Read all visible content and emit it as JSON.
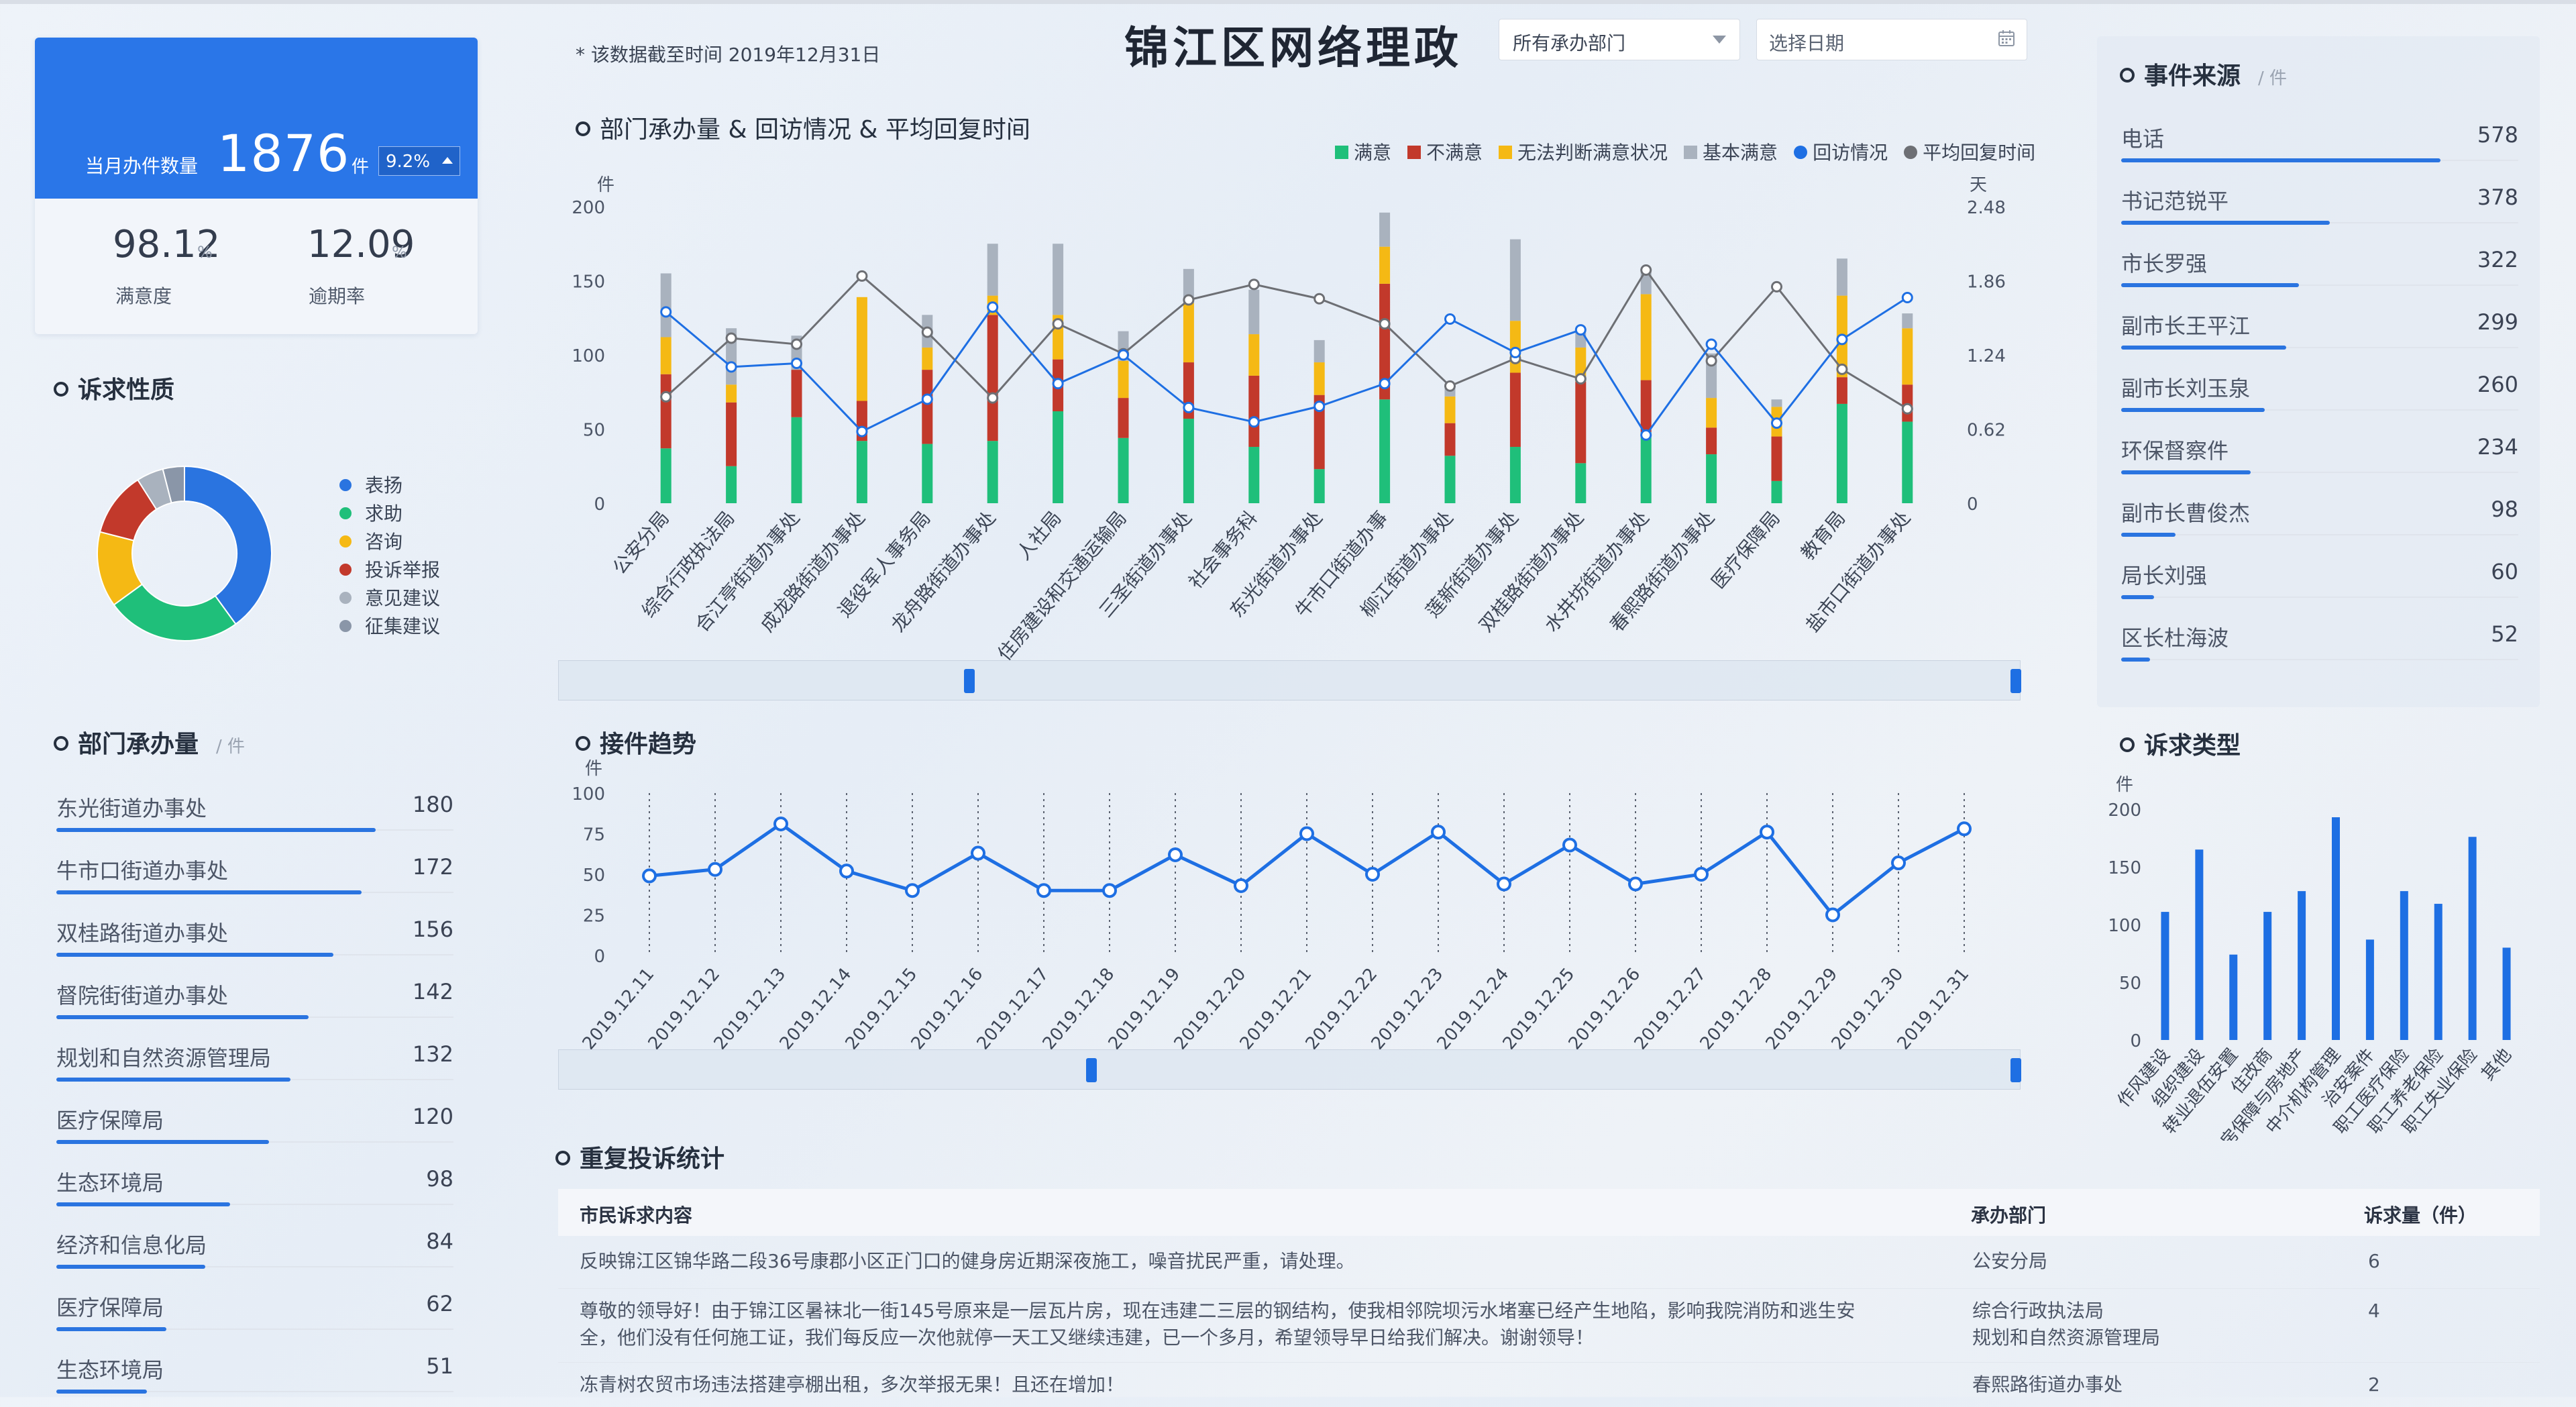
{
  "kpi": {
    "monthly_label": "当月办件数量",
    "monthly_value": "1876",
    "monthly_unit": "件",
    "monthly_change": "9.2%",
    "satisfaction_value": "98.12",
    "satisfaction_unit": "%",
    "satisfaction_label": "满意度",
    "overdue_value": "12.09",
    "overdue_unit": "%",
    "overdue_label": "逾期率"
  },
  "header": {
    "note": "* 该数据截至时间 2019年12月31日",
    "title": "锦江区网络理政",
    "dept_select": "所有承办部门",
    "date_placeholder": "选择日期"
  },
  "appeal_nature": {
    "title": "诉求性质",
    "items": [
      {
        "label": "表扬",
        "value": 40,
        "color": "#2a74e0"
      },
      {
        "label": "求助",
        "value": 25,
        "color": "#1fbf7a"
      },
      {
        "label": "咨询",
        "value": 14,
        "color": "#f5b914"
      },
      {
        "label": "投诉举报",
        "value": 12,
        "color": "#c2392b"
      },
      {
        "label": "意见建议",
        "value": 5,
        "color": "#a9b2be"
      },
      {
        "label": "征集建议",
        "value": 4,
        "color": "#8a96a8"
      }
    ]
  },
  "dept_volume": {
    "title": "部门承办量",
    "unit": "/ 件",
    "items": [
      {
        "name": "东光街道办事处",
        "value": 180
      },
      {
        "name": "牛市口街道办事处",
        "value": 172
      },
      {
        "name": "双桂路街道办事处",
        "value": 156
      },
      {
        "name": "督院街街道办事处",
        "value": 142
      },
      {
        "name": "规划和自然资源管理局",
        "value": 132
      },
      {
        "name": "医疗保障局",
        "value": 120
      },
      {
        "name": "生态环境局",
        "value": 98
      },
      {
        "name": "经济和信息化局",
        "value": 84
      },
      {
        "name": "医疗保障局",
        "value": 62
      },
      {
        "name": "生态环境局",
        "value": 51
      }
    ]
  },
  "event_source": {
    "title": "事件来源",
    "unit": "/ 件",
    "items": [
      {
        "name": "电话",
        "value": 578
      },
      {
        "name": "书记范锐平",
        "value": 378
      },
      {
        "name": "市长罗强",
        "value": 322
      },
      {
        "name": "副市长王平江",
        "value": 299
      },
      {
        "name": "副市长刘玉泉",
        "value": 260
      },
      {
        "name": "环保督察件",
        "value": 234
      },
      {
        "name": "副市长曹俊杰",
        "value": 98
      },
      {
        "name": "局长刘强",
        "value": 60
      },
      {
        "name": "区长杜海波",
        "value": 52
      }
    ]
  },
  "chart_data": [
    {
      "type": "bar",
      "title": "部门承办量 & 回访情况 & 平均回复时间",
      "ylabel": "件",
      "y2label": "天",
      "ylim": [
        0,
        200
      ],
      "y2lim": [
        0,
        2.48
      ],
      "yticks": [
        "0",
        "50",
        "100",
        "150",
        "200"
      ],
      "y2ticks": [
        "0",
        "0.62",
        "1.24",
        "1.86",
        "2.48"
      ],
      "legend_position": "top-right",
      "categories": [
        "公安分局",
        "综合行政执法局",
        "合江亭街道办事处",
        "成龙路街道办事处",
        "退役军人事务局",
        "龙舟路街道办事处",
        "人社局",
        "住房建设和交通运输局",
        "三圣街道办事处",
        "社会事务科",
        "东光街道办事处",
        "牛市口街道办事",
        "柳江街道办事处",
        "莲新街道办事处",
        "双桂路街道办事处",
        "水井坊街道办事处",
        "春熙路街道办事处",
        "医疗保障局",
        "教育局",
        "盐市口街道办事处"
      ],
      "stack_colors": [
        "#1fbf7a",
        "#c2392b",
        "#f5b914",
        "#a9b2be"
      ],
      "series": [
        {
          "name": "满意",
          "values": [
            37,
            25,
            58,
            42,
            40,
            42,
            62,
            44,
            57,
            38,
            23,
            70,
            32,
            38,
            27,
            48,
            33,
            15,
            67,
            55
          ]
        },
        {
          "name": "不满意",
          "values": [
            50,
            43,
            32,
            27,
            50,
            85,
            35,
            27,
            38,
            48,
            50,
            78,
            22,
            50,
            55,
            35,
            18,
            30,
            18,
            25
          ]
        },
        {
          "name": "无法判断满意状况",
          "values": [
            25,
            12,
            0,
            70,
            15,
            13,
            30,
            25,
            40,
            28,
            22,
            25,
            18,
            35,
            23,
            58,
            20,
            20,
            55,
            38
          ]
        },
        {
          "name": "基本满意",
          "values": [
            43,
            38,
            23,
            0,
            22,
            35,
            48,
            20,
            23,
            30,
            15,
            23,
            8,
            55,
            10,
            15,
            30,
            5,
            25,
            10
          ]
        },
        {
          "name": "回访情况",
          "values": [
            1.6,
            1.14,
            1.17,
            0.6,
            0.87,
            1.64,
            1.0,
            1.24,
            0.8,
            0.68,
            0.81,
            1.0,
            1.54,
            1.26,
            1.45,
            0.57,
            1.33,
            0.67,
            1.37,
            1.72
          ]
        },
        {
          "name": "平均回复时间",
          "values": [
            0.89,
            1.38,
            1.33,
            1.9,
            1.43,
            0.88,
            1.5,
            1.25,
            1.7,
            1.83,
            1.71,
            1.5,
            0.98,
            1.21,
            1.04,
            1.95,
            1.19,
            1.81,
            1.12,
            0.79
          ]
        }
      ]
    },
    {
      "type": "line",
      "title": "接件趋势",
      "ylabel": "件",
      "ylim": [
        0,
        100
      ],
      "yticks": [
        "0",
        "25",
        "50",
        "75",
        "100"
      ],
      "grid": true,
      "categories": [
        "2019.12.11",
        "2019.12.12",
        "2019.12.13",
        "2019.12.14",
        "2019.12.15",
        "2019.12.16",
        "2019.12.17",
        "2019.12.18",
        "2019.12.19",
        "2019.12.20",
        "2019.12.21",
        "2019.12.22",
        "2019.12.23",
        "2019.12.24",
        "2019.12.25",
        "2019.12.26",
        "2019.12.27",
        "2019.12.28",
        "2019.12.29",
        "2019.12.30",
        "2019.12.31"
      ],
      "values": [
        49,
        53,
        81,
        52,
        40,
        63,
        40,
        40,
        62,
        43,
        75,
        50,
        76,
        44,
        68,
        44,
        50,
        76,
        25,
        57,
        78
      ]
    },
    {
      "type": "bar",
      "title": "诉求类型",
      "ylabel": "件",
      "ylim": [
        0,
        200
      ],
      "yticks": [
        "0",
        "50",
        "100",
        "150",
        "200"
      ],
      "categories": [
        "作风建设",
        "组织建设",
        "转业退伍安置",
        "住改商",
        "住房保障与房地产",
        "中介机构管理",
        "治安案件",
        "职工医疗保险",
        "职工养老保险",
        "职工失业保险",
        "其他"
      ],
      "values": [
        111,
        165,
        74,
        111,
        129,
        193,
        87,
        129,
        118,
        176,
        80
      ]
    }
  ],
  "repeat_complaints": {
    "title": "重复投诉统计",
    "headers": [
      "市民诉求内容",
      "承办部门",
      "诉求量（件）"
    ],
    "rows": [
      {
        "content": [
          "反映锦江区锦华路二段36号康郡小区正门口的健身房近期深夜施工，噪音扰民严重，请处理。"
        ],
        "dept": [
          "公安分局"
        ],
        "count": "6"
      },
      {
        "content": [
          "尊敬的领导好！由于锦江区暑袜北一街145号原来是一层瓦片房，现在违建二三层的钢结构，使我相邻院坝污水堵塞已经产生地陷，影响我院消防和逃生安",
          "全，他们没有任何施工证，我们每反应一次他就停一天工又继续违建，已一个多月，希望领导早日给我们解决。谢谢领导！"
        ],
        "dept": [
          "综合行政执法局",
          "规划和自然资源管理局"
        ],
        "count": "4"
      },
      {
        "content": [
          "冻青树农贸市场违法搭建亭棚出租，多次举报无果！且还在增加！"
        ],
        "dept": [
          "春熙路街道办事处"
        ],
        "count": "2"
      }
    ]
  }
}
